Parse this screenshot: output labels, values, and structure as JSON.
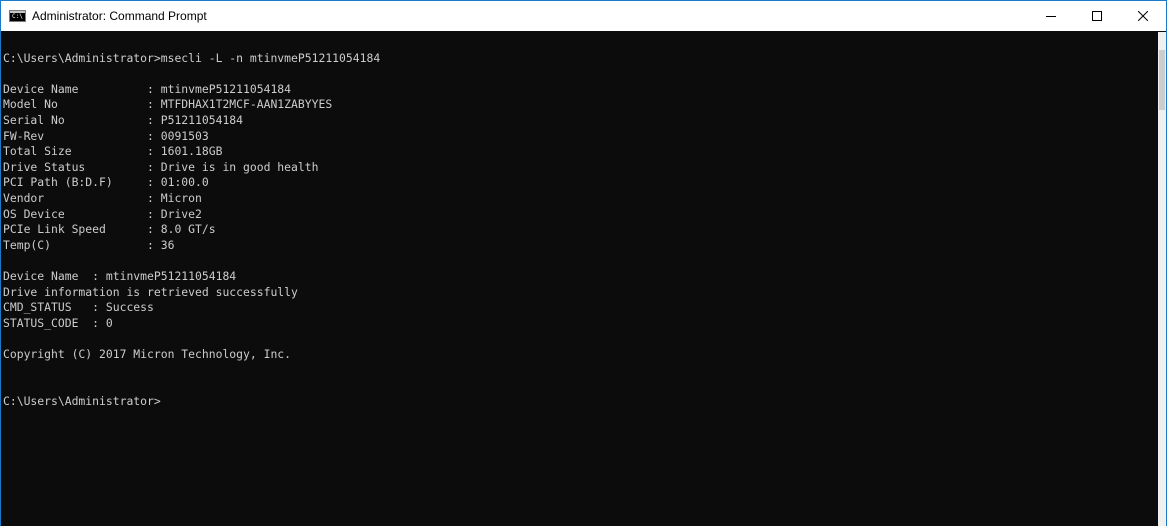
{
  "window": {
    "title": "Administrator: Command Prompt",
    "icon": "cmd-icon",
    "controls": {
      "minimize_icon": "minimize-icon",
      "maximize_icon": "maximize-icon",
      "close_icon": "close-icon"
    }
  },
  "console": {
    "lines": [
      "",
      "C:\\Users\\Administrator>msecli -L -n mtinvmeP51211054184",
      "",
      "Device Name          : mtinvmeP51211054184",
      "Model No             : MTFDHAX1T2MCF-AAN1ZABYYES",
      "Serial No            : P51211054184",
      "FW-Rev               : 0091503",
      "Total Size           : 1601.18GB",
      "Drive Status         : Drive is in good health",
      "PCI Path (B:D.F)     : 01:00.0",
      "Vendor               : Micron",
      "OS Device            : Drive2",
      "PCIe Link Speed      : 8.0 GT/s",
      "Temp(C)              : 36",
      "",
      "Device Name  : mtinvmeP51211054184",
      "Drive information is retrieved successfully",
      "CMD_STATUS   : Success",
      "STATUS_CODE  : 0",
      "",
      "Copyright (C) 2017 Micron Technology, Inc.",
      "",
      "",
      "C:\\Users\\Administrator>"
    ]
  },
  "colors": {
    "console_background": "#0c0c0c",
    "console_text": "#cccccc",
    "titlebar_background": "#ffffff",
    "window_border": "#1979ca"
  }
}
